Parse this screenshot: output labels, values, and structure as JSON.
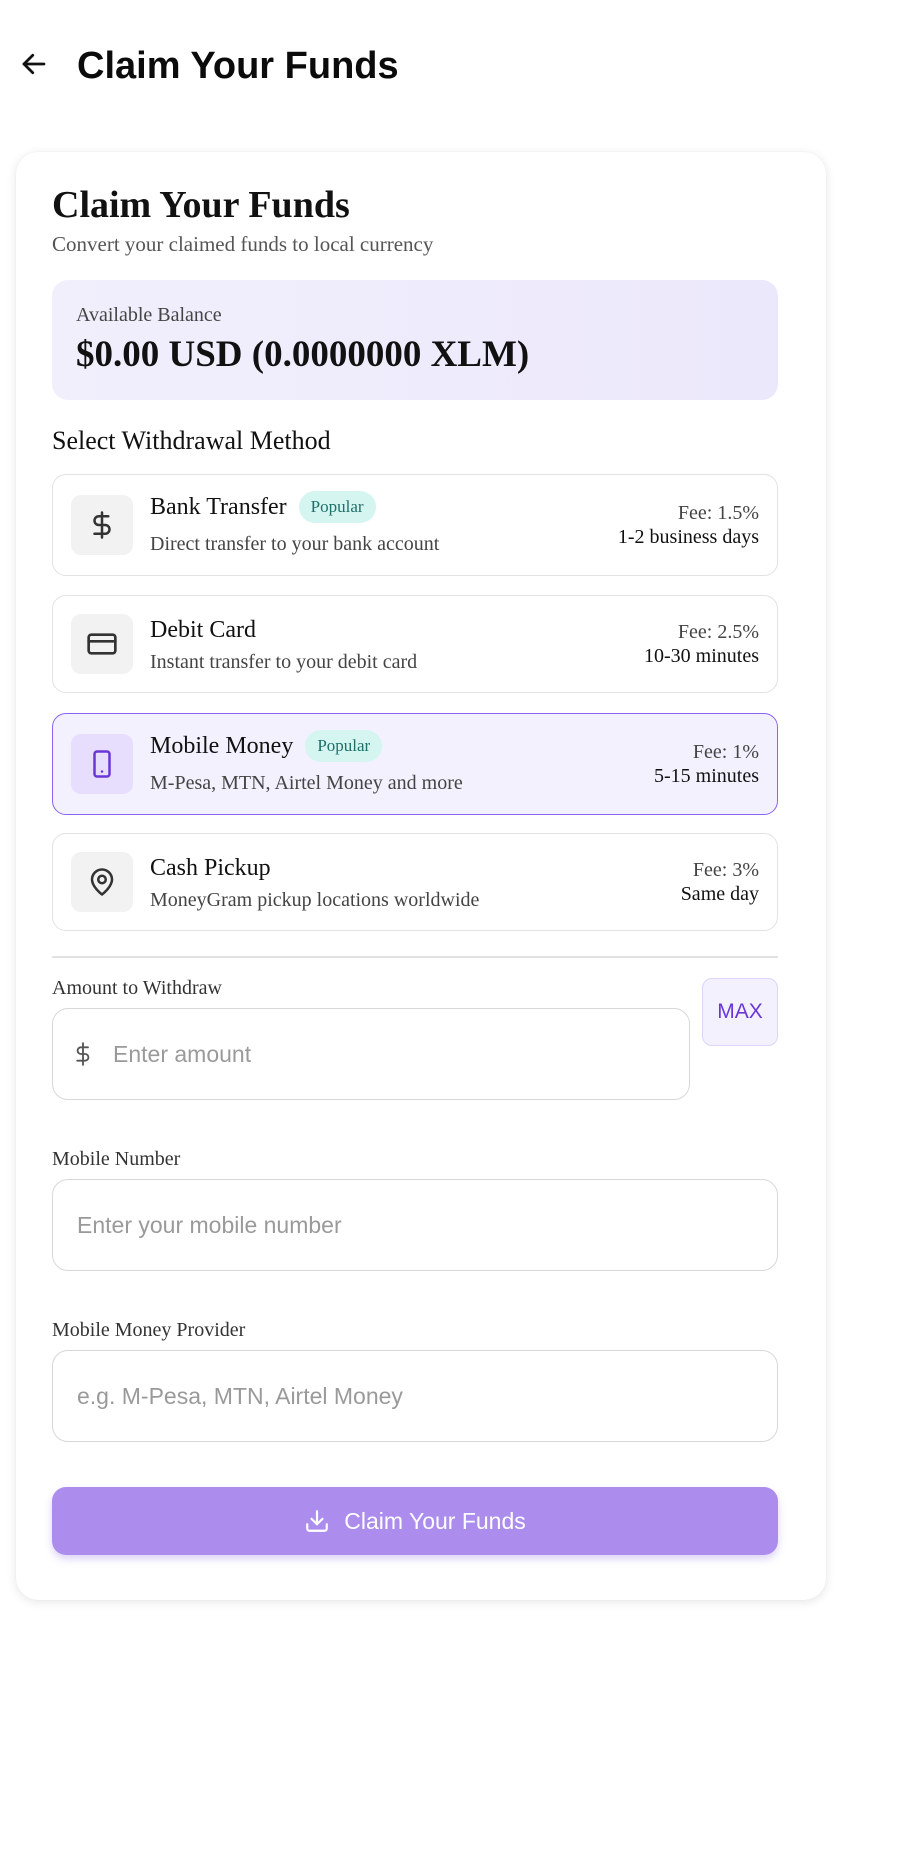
{
  "header": {
    "title": "Claim Your Funds"
  },
  "card": {
    "title": "Claim Your Funds",
    "subtitle": "Convert your claimed funds to local currency",
    "balance": {
      "label": "Available Balance",
      "amount": "$0.00 USD (0.0000000 XLM)"
    },
    "methods_title": "Select Withdrawal Method",
    "methods": [
      {
        "name": "Bank Transfer",
        "badge": "Popular",
        "description": "Direct transfer to your bank account",
        "fee": "Fee: 1.5%",
        "time": "1-2 business days",
        "icon": "dollar-icon",
        "selected": false
      },
      {
        "name": "Debit Card",
        "badge": "",
        "description": "Instant transfer to your debit card",
        "fee": "Fee: 2.5%",
        "time": "10-30 minutes",
        "icon": "credit-card-icon",
        "selected": false
      },
      {
        "name": "Mobile Money",
        "badge": "Popular",
        "description": "M-Pesa, MTN, Airtel Money and more",
        "fee": "Fee: 1%",
        "time": "5-15 minutes",
        "icon": "mobile-phone-icon",
        "selected": true
      },
      {
        "name": "Cash Pickup",
        "badge": "",
        "description": "MoneyGram pickup locations worldwide",
        "fee": "Fee: 3%",
        "time": "Same day",
        "icon": "map-pin-icon",
        "selected": false
      }
    ],
    "amount": {
      "label": "Amount to Withdraw",
      "placeholder": "Enter amount",
      "value": "",
      "max_label": "MAX"
    },
    "mobile_number": {
      "label": "Mobile Number",
      "placeholder": "Enter your mobile number",
      "value": ""
    },
    "provider": {
      "label": "Mobile Money Provider",
      "placeholder": "e.g. M-Pesa, MTN, Airtel Money",
      "value": ""
    },
    "submit_label": "Claim Your Funds"
  },
  "colors": {
    "accent": "#8b63f0",
    "button": "#ac8dee",
    "badge_bg": "#d5f5f1",
    "badge_text": "#1f6f69",
    "balance_bg": "#efecfc"
  }
}
